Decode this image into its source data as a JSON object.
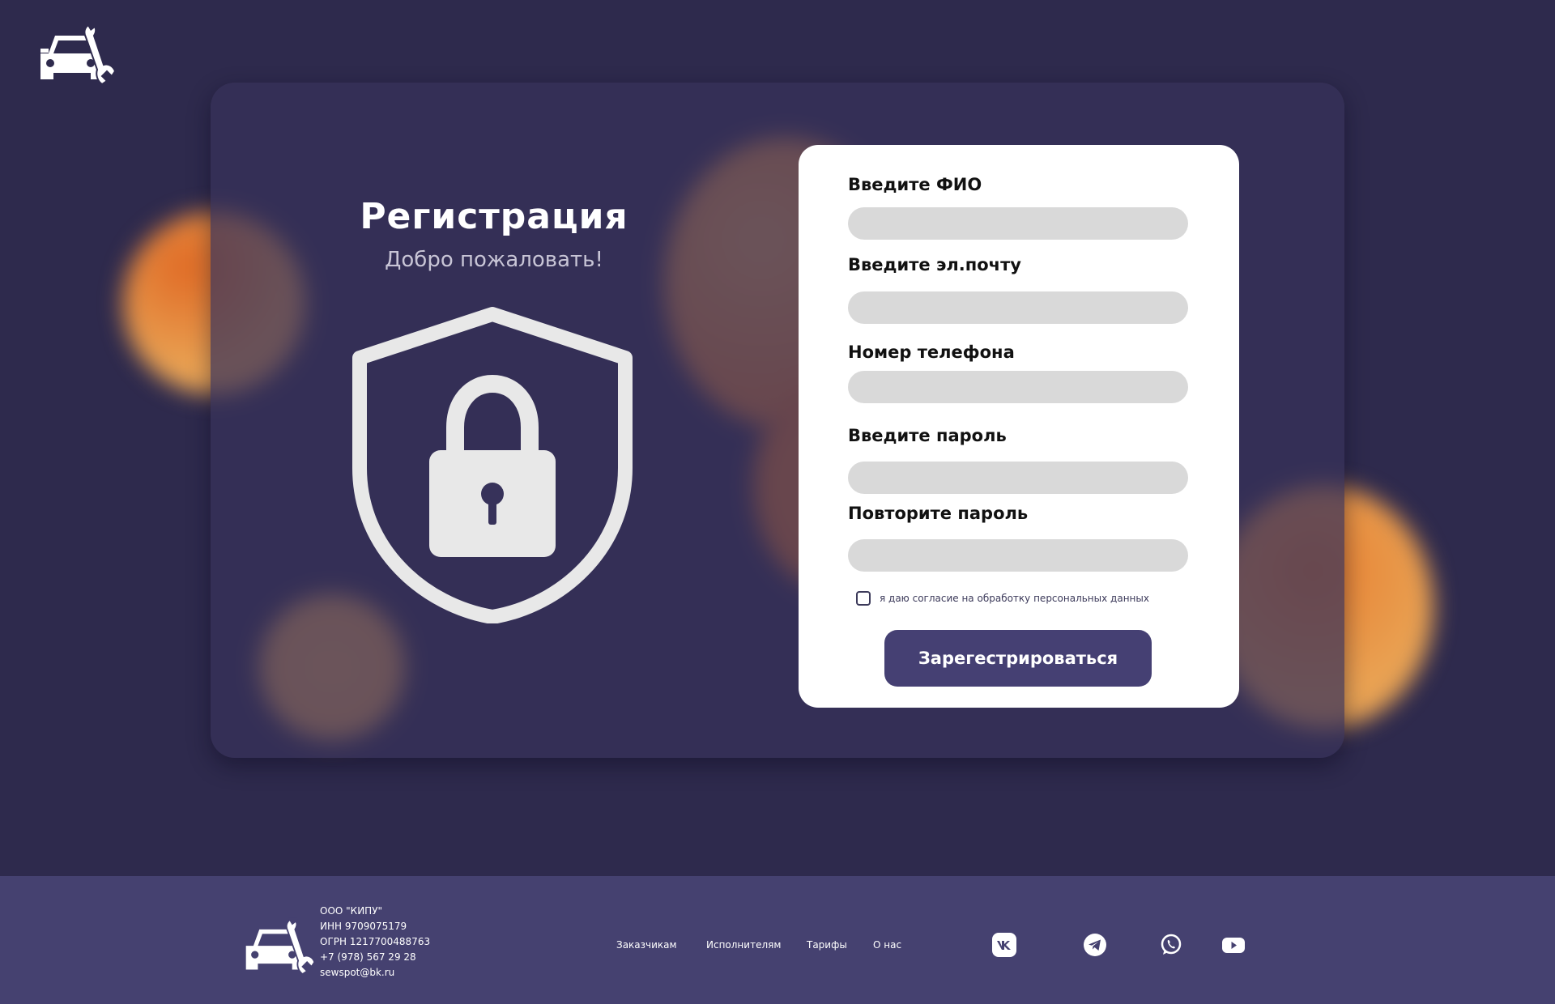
{
  "header": {
    "logo_icon": "car-wrench-logo-icon"
  },
  "intro": {
    "title": "Регистрация",
    "subtitle": "Добро пожаловать!",
    "illustration": "shield-lock-icon"
  },
  "form": {
    "fio_label": "Введите ФИО",
    "fio_value": "",
    "email_label": "Введите эл.почту",
    "email_value": "",
    "phone_label": "Номер телефона",
    "phone_value": "",
    "password_label": "Введите пароль",
    "password_value": "",
    "repeat_label": "Повторите пароль",
    "repeat_value": "",
    "consent_text": "я даю согласие на обработку персональных данных",
    "consent_checked": false,
    "submit_label": "Зарегестрироваться"
  },
  "footer": {
    "company": {
      "name": "ООО \"КИПУ\"",
      "inn": "ИНН 9709075179",
      "ogrn": "ОГРН 1217700488763",
      "phone": "+7 (978) 567 29 28",
      "email": "sewspot@bk.ru"
    },
    "nav": [
      "Заказчикам",
      "Исполнителям",
      "Тарифы",
      "О нас"
    ],
    "social": [
      "vk-icon",
      "telegram-icon",
      "whatsapp-icon",
      "youtube-icon"
    ]
  },
  "colors": {
    "background": "#2e2a4d",
    "card": "#37325a",
    "accent": "#454073",
    "orange": "#e9a354",
    "field": "#d9d9d9"
  }
}
